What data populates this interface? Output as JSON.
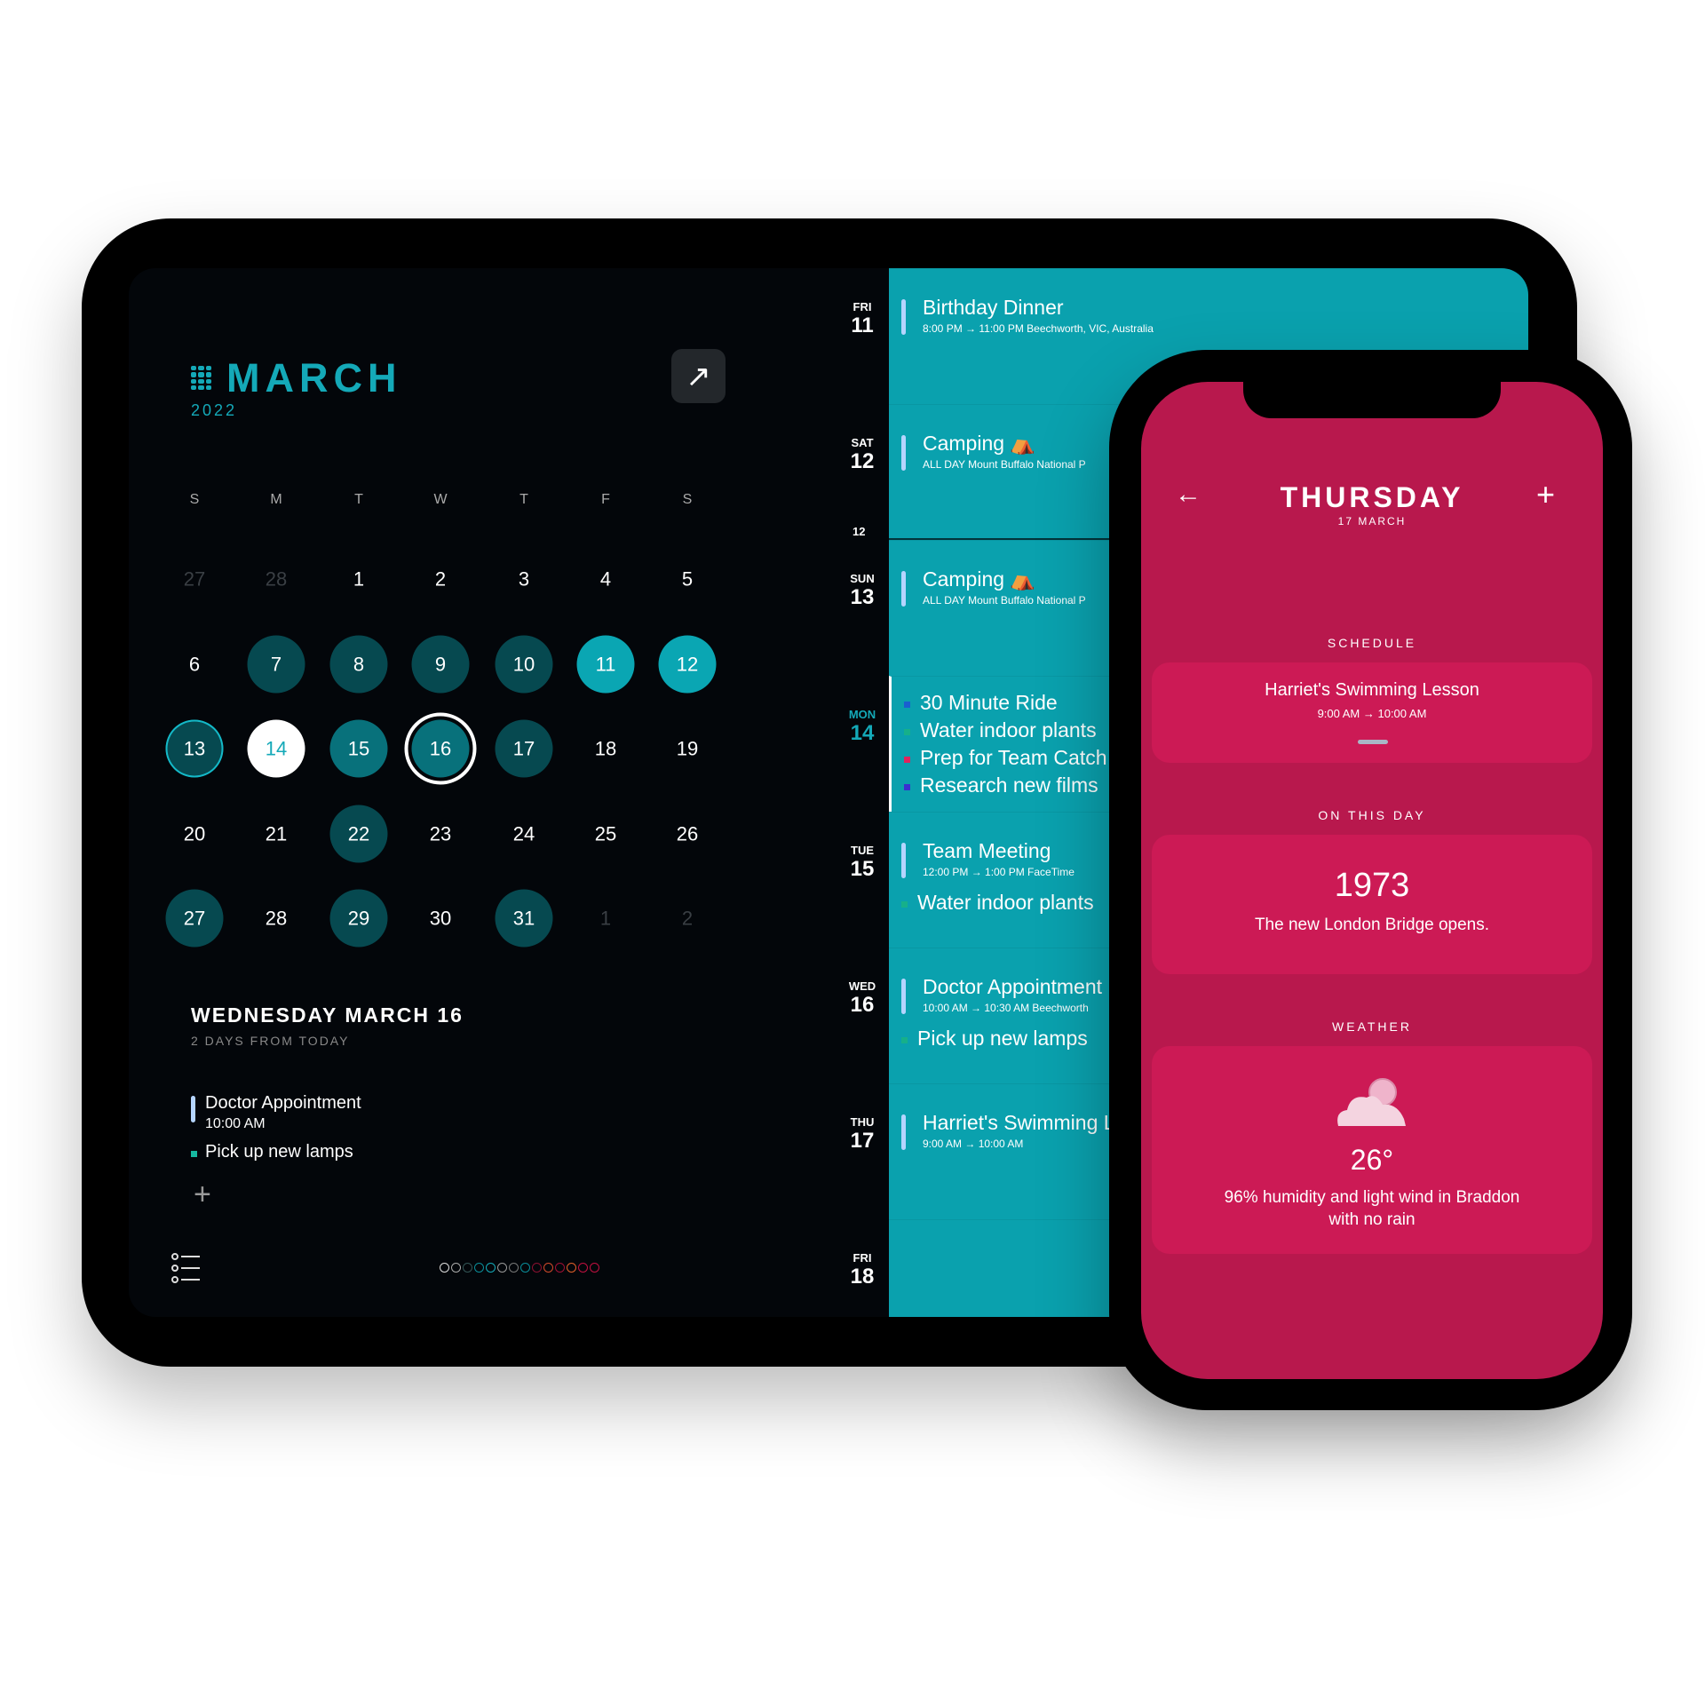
{
  "tablet": {
    "month": "MARCH",
    "year": "2022",
    "weekdays": [
      "S",
      "M",
      "T",
      "W",
      "T",
      "F",
      "S"
    ],
    "weeks": [
      [
        "27",
        "28",
        "1",
        "2",
        "3",
        "4",
        "5"
      ],
      [
        "6",
        "7",
        "8",
        "9",
        "10",
        "11",
        "12"
      ],
      [
        "13",
        "14",
        "15",
        "16",
        "17",
        "18",
        "19"
      ],
      [
        "20",
        "21",
        "22",
        "23",
        "24",
        "25",
        "26"
      ],
      [
        "27",
        "28",
        "29",
        "30",
        "31",
        "1",
        "2"
      ]
    ],
    "selected_title": "WEDNESDAY MARCH 16",
    "selected_subtitle": "2 DAYS FROM TODAY",
    "selected_events": [
      {
        "title": "Doctor Appointment",
        "time": "10:00 AM"
      },
      {
        "title": "Pick up new lamps"
      }
    ],
    "theme_dot_colors": [
      "#dddddd",
      "#aaaaaa",
      "#335555",
      "#0a8c98",
      "#14a9b8",
      "#999999",
      "#777777",
      "#0a8c98",
      "#8a1030",
      "#d04a2a",
      "#a01035",
      "#e0602a",
      "#c01040",
      "#c01040"
    ],
    "agenda": [
      {
        "dow": "FRI",
        "date": "11",
        "events": [
          {
            "kind": "event",
            "title": "Birthday Dinner",
            "sub": "8:00 PM → 11:00 PM   Beechworth, VIC, Australia"
          }
        ]
      },
      {
        "dow": "SAT",
        "date": "12",
        "events": [
          {
            "kind": "event",
            "title": "Camping ⛺",
            "sub": "ALL DAY   Mount Buffalo National P"
          }
        ],
        "hour_marker": "12"
      },
      {
        "dow": "SUN",
        "date": "13",
        "events": [
          {
            "kind": "event",
            "title": "Camping ⛺",
            "sub": "ALL DAY   Mount Buffalo National P"
          }
        ]
      },
      {
        "dow": "MON",
        "date": "14",
        "events": [
          {
            "kind": "task",
            "title": "30 Minute Ride",
            "color": "#1a5fd0"
          },
          {
            "kind": "task",
            "title": "Water indoor plants",
            "color": "#16b08a"
          },
          {
            "kind": "task",
            "title": "Prep for Team Catch",
            "color": "#e0245e"
          },
          {
            "kind": "task",
            "title": "Research new films",
            "color": "#3a2fd0"
          }
        ]
      },
      {
        "dow": "TUE",
        "date": "15",
        "events": [
          {
            "kind": "event",
            "title": "Team Meeting",
            "sub": "12:00 PM → 1:00 PM   FaceTime"
          },
          {
            "kind": "task",
            "title": "Water indoor plants",
            "color": "#16b08a"
          }
        ]
      },
      {
        "dow": "WED",
        "date": "16",
        "events": [
          {
            "kind": "event",
            "title": "Doctor Appointment",
            "sub": "10:00 AM → 10:30 AM   Beechworth"
          },
          {
            "kind": "task",
            "title": "Pick up new lamps",
            "color": "#16b08a"
          }
        ]
      },
      {
        "dow": "THU",
        "date": "17",
        "events": [
          {
            "kind": "event",
            "title": "Harriet's Swimming Lesson",
            "sub": "9:00 AM → 10:00 AM"
          }
        ]
      },
      {
        "dow": "FRI",
        "date": "18",
        "events": []
      }
    ]
  },
  "phone": {
    "title": "THURSDAY",
    "subtitle": "17 MARCH",
    "schedule_label": "SCHEDULE",
    "schedule_event": {
      "title": "Harriet's Swimming Lesson",
      "time": "9:00 AM → 10:00 AM"
    },
    "on_this_day_label": "ON THIS DAY",
    "on_this_day": {
      "year": "1973",
      "text": "The new London Bridge opens."
    },
    "weather_label": "WEATHER",
    "weather": {
      "icon": "partly-cloudy-icon",
      "temp": "26°",
      "line1": "96% humidity and light wind in Braddon",
      "line2": "with no rain"
    }
  },
  "colors": {
    "teal": "#0aa1ae",
    "accent": "#14a9b8",
    "crimson": "#b8184d",
    "card": "#cc1a55"
  }
}
